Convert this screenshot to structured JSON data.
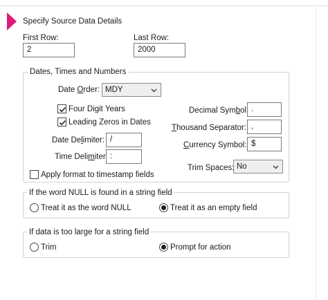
{
  "header": {
    "title": "Specify Source Data Details"
  },
  "rows": {
    "first_row_label": "First Row:",
    "first_row_value": "2",
    "last_row_label": "Last Row:",
    "last_row_value": "2000"
  },
  "dates_group": {
    "legend": "Dates, Times and Numbers",
    "date_order_label": "Date Order:",
    "date_order_value": "MDY",
    "four_digit_years_label": "Four Digit Years",
    "four_digit_years_checked": true,
    "leading_zeros_label": "Leading Zeros in Dates",
    "leading_zeros_checked": true,
    "date_delimiter_label": "Date Delimiter:",
    "date_delimiter_value": "/",
    "time_delimiter_label": "Time Delimiter:",
    "time_delimiter_value": ":",
    "apply_format_label": "Apply format to timestamp fields",
    "apply_format_checked": false,
    "decimal_symbol_label": "Decimal Symbol:",
    "decimal_symbol_value": ".",
    "thousand_separator_label": "Thousand Separator:",
    "thousand_separator_value": ",",
    "currency_symbol_label": "Currency Symbol:",
    "currency_symbol_value": "$",
    "trim_spaces_label": "Trim Spaces:",
    "trim_spaces_value": "No"
  },
  "null_group": {
    "legend": "If the word NULL is found in a string field",
    "option_word_null": "Treat it as the word NULL",
    "option_empty_field": "Treat it as an empty field",
    "selected": "option_empty_field"
  },
  "large_group": {
    "legend": "If data is too large for a string field",
    "option_trim": "Trim",
    "option_prompt": "Prompt for action",
    "selected": "option_prompt"
  },
  "colors": {
    "accent": "#e0197c",
    "group_border": "#d2d2d2"
  },
  "icons": [
    "chevron-down-icon",
    "checkmark-icon",
    "radio-dot-icon",
    "step-marker-icon"
  ]
}
